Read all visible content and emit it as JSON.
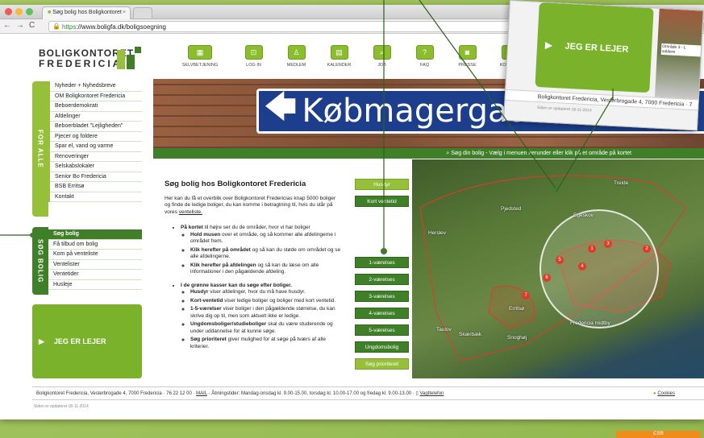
{
  "browser": {
    "tab_title": "Søg bolig hos Boligkontoret",
    "url_scheme": "https",
    "url": "://www.boligfa.dk/boligsoegning"
  },
  "logo": {
    "line1": "BOLIGKONTORET",
    "line2": "FREDERICIA"
  },
  "topnav": [
    {
      "label": "SELVBETJENING",
      "icon": "grid-icon"
    },
    {
      "label": "LOG IN",
      "icon": "lock-icon"
    },
    {
      "label": "MEDLEM",
      "icon": "person-icon"
    },
    {
      "label": "KALENDER",
      "icon": "calendar-icon"
    },
    {
      "label": "JOB",
      "icon": "search-icon"
    },
    {
      "label": "FAQ",
      "icon": "question-icon"
    },
    {
      "label": "PRESSE",
      "icon": "camera-icon"
    },
    {
      "label": "KONTAKT",
      "icon": "video-icon"
    }
  ],
  "sidebar": {
    "tab_for_alle": "FOR ALLE",
    "tab_sog_bolig": "SØG BOLIG",
    "for_alle_items": [
      "Nyheder + Nyhedsbreve",
      "OM Boligkontoret Fredericia",
      "Beboerdemokrati",
      "Afdelinger",
      "Beboerbladet \"Lejligheden\"",
      "Pjecer og foldere",
      "Spar el, vand og varme",
      "Renoveringer",
      "Selskabslokaler",
      "Senior Bo Fredericia",
      "BSB Erritsø",
      "Kontakt"
    ],
    "sog_items": [
      "Søg bolig",
      "Få tilbud om bolig",
      "Kom på venteliste",
      "Ventelister",
      "Ventetider",
      "Husleje"
    ],
    "leje_button": "JEG ER LEJER"
  },
  "banner": {
    "sign_text": "Købmagergade 4"
  },
  "searchbar": {
    "text": "Søg din bolig - Vælg i menuen herunder eller klik på et område på kortet"
  },
  "content": {
    "title": "Søg bolig hos Boligkontoret Fredericia",
    "intro_pre": "Her kan du få et overblik over Boligkontoret Fredericias knap 5000 boliger og finde de ledige boliger, du kan komme i betragtning til, hvis du står på vores ",
    "intro_link": "venteliste.",
    "b1_title": "På kortet",
    "b1_text": " til højre ser du de områder, hvor vi har boliger",
    "b1_sub": [
      {
        "bold": "Hold musen",
        "text": " over et område, og så kommer alle afdelingerne i området frem."
      },
      {
        "bold": "Klik herefter på området",
        "text": " og så kan du støde om området og se alle afdelingerne."
      },
      {
        "bold": "Klik herefter på afdelingen",
        "text": " og så kan du læse om alle informationer i den pågældende afdeling."
      }
    ],
    "b2_title": "I de grønne kasser kan du søge efter boliger.",
    "b2_sub": [
      {
        "bold": "Husdyr",
        "text": " viser afdelinger, hvor du må have husdyr."
      },
      {
        "bold": "Kort-ventetid",
        "text": " viser ledige boliger og boliger med kort ventetid."
      },
      {
        "bold": "1-5-værelser",
        "text": " viser boliger i den pågældende størrelse, du kan skrive dig op til, men som aktuelt ikke er ledige."
      },
      {
        "bold": "Ungdomsboliger/studieboliger",
        "text": " skal du være studerende og under uddannelse for at kunne søge."
      },
      {
        "bold": "Søg prioriteret",
        "text": " giver mulighed for at søge på tværs af alle kriterier."
      }
    ]
  },
  "filters": {
    "husdyr": "Husdyr",
    "kort_ventetid": "Kort ventetid",
    "v1": "1-værelses",
    "v2": "2-værelses",
    "v3": "3-værelses",
    "v4": "4-værelses",
    "v5": "5-værelses",
    "ungdom": "Ungdomsbolig",
    "prioriteret": "Søg prioriteret"
  },
  "map": {
    "labels": [
      "Trelde",
      "Pjedsted",
      "Egeskov",
      "Herslev",
      "Erritsø",
      "Taulov",
      "Skærbæk",
      "Snoghøj",
      "Fredericia midtby"
    ],
    "pins": [
      "1",
      "2",
      "3",
      "4",
      "5",
      "6",
      "7"
    ]
  },
  "footer": {
    "address": "Boligkontoret Fredericia, Vesterbrogade 4, 7000 Fredericia",
    "phone": "76 22 12 00",
    "mail": "MAIL",
    "hours": "Åbningstider: Mandag-onsdag kl. 9.00-15.00, torsdag kl. 10.00-17.00 og fredag kl. 9.00-13.00",
    "vagt": "Vagttelefon",
    "cookies": "Cookies",
    "updated": "Siden er opdateret 18-11-2014"
  },
  "zoom": {
    "leje_button": "JEG ER LEJER",
    "caption": "Område 3 - L soldere",
    "footer": "Boligkontoret Fredericia, Vesterbrogade 4, 7000 Fredericia · 7",
    "updated": "Siden er opdateret 18-11-2014"
  },
  "badge": "CSR"
}
